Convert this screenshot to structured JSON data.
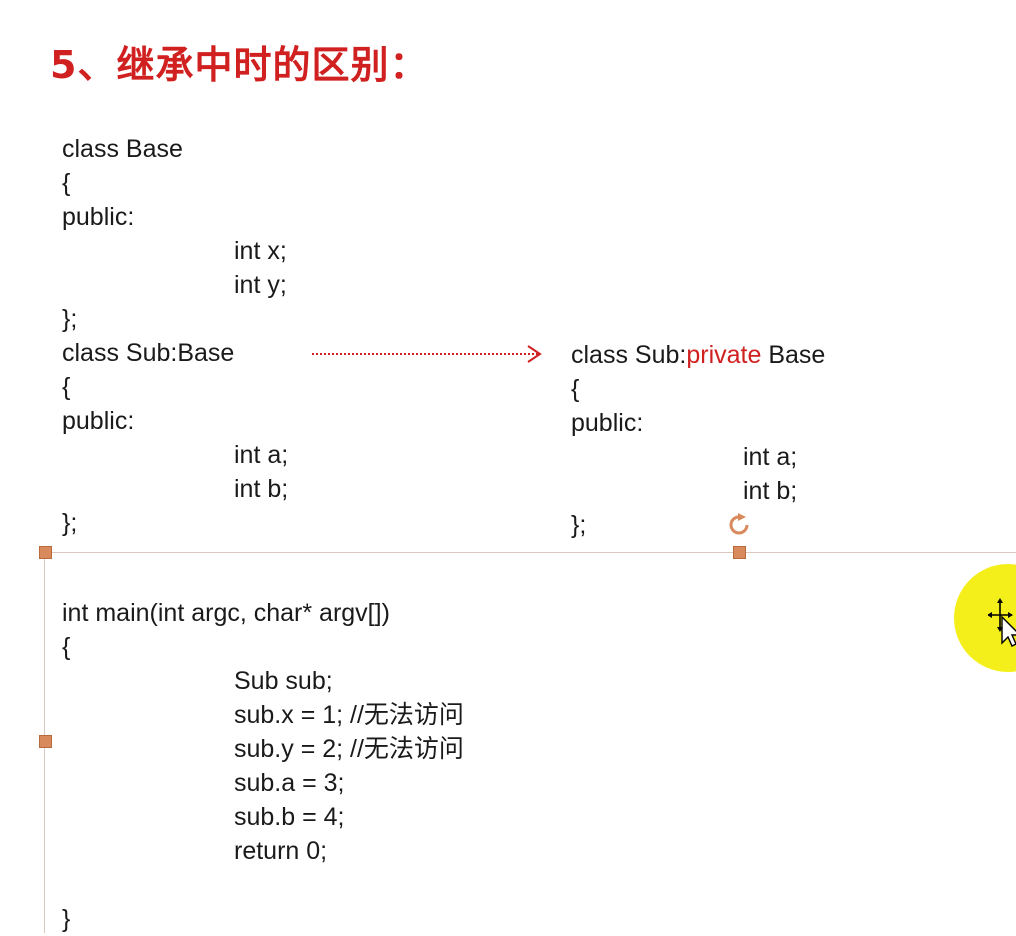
{
  "slide": {
    "title": "5、继承中时的区别："
  },
  "left_code": {
    "lines": [
      {
        "text": "class Base",
        "indent": false
      },
      {
        "text": "{",
        "indent": false
      },
      {
        "text": "public:",
        "indent": false
      },
      {
        "text": "int x;",
        "indent": true
      },
      {
        "text": "int y;",
        "indent": true
      },
      {
        "text": "};",
        "indent": false
      },
      {
        "text": "class Sub:Base",
        "indent": false
      },
      {
        "text": "{",
        "indent": false
      },
      {
        "text": "public:",
        "indent": false
      },
      {
        "text": "int a;",
        "indent": true
      },
      {
        "text": "int b;",
        "indent": true
      },
      {
        "text": "};",
        "indent": false
      }
    ]
  },
  "right_code": {
    "header_prefix": "class Sub:",
    "header_keyword": "private",
    "header_suffix": " Base",
    "lines": [
      {
        "text": "{",
        "indent": false
      },
      {
        "text": "public:",
        "indent": false
      },
      {
        "text": "int a;",
        "indent": true
      },
      {
        "text": "int b;",
        "indent": true
      },
      {
        "text": "};",
        "indent": false
      }
    ]
  },
  "main_code": {
    "lines": [
      {
        "text": "int main(int argc, char* argv[])",
        "indent": false
      },
      {
        "text": "{",
        "indent": false
      },
      {
        "text": "Sub sub;",
        "indent": true
      },
      {
        "text": "sub.x = 1;  //无法访问",
        "indent": true
      },
      {
        "text": "sub.y = 2;  //无法访问",
        "indent": true
      },
      {
        "text": "sub.a = 3;",
        "indent": true
      },
      {
        "text": "sub.b = 4;",
        "indent": true
      },
      {
        "text": "return 0;",
        "indent": true
      },
      {
        "text": "",
        "indent": false
      },
      {
        "text": "}",
        "indent": false
      }
    ]
  },
  "colors": {
    "title": "#d02020",
    "keyword_highlight": "#d02020",
    "arrow": "#d02020",
    "cursor_highlight": "#f4ef1a",
    "selection_handle": "#d88a5c"
  },
  "icons": {
    "arrow": "dotted-right-arrow-icon",
    "rotate": "rotate-handle-icon",
    "cursor": "move-cursor-icon"
  }
}
